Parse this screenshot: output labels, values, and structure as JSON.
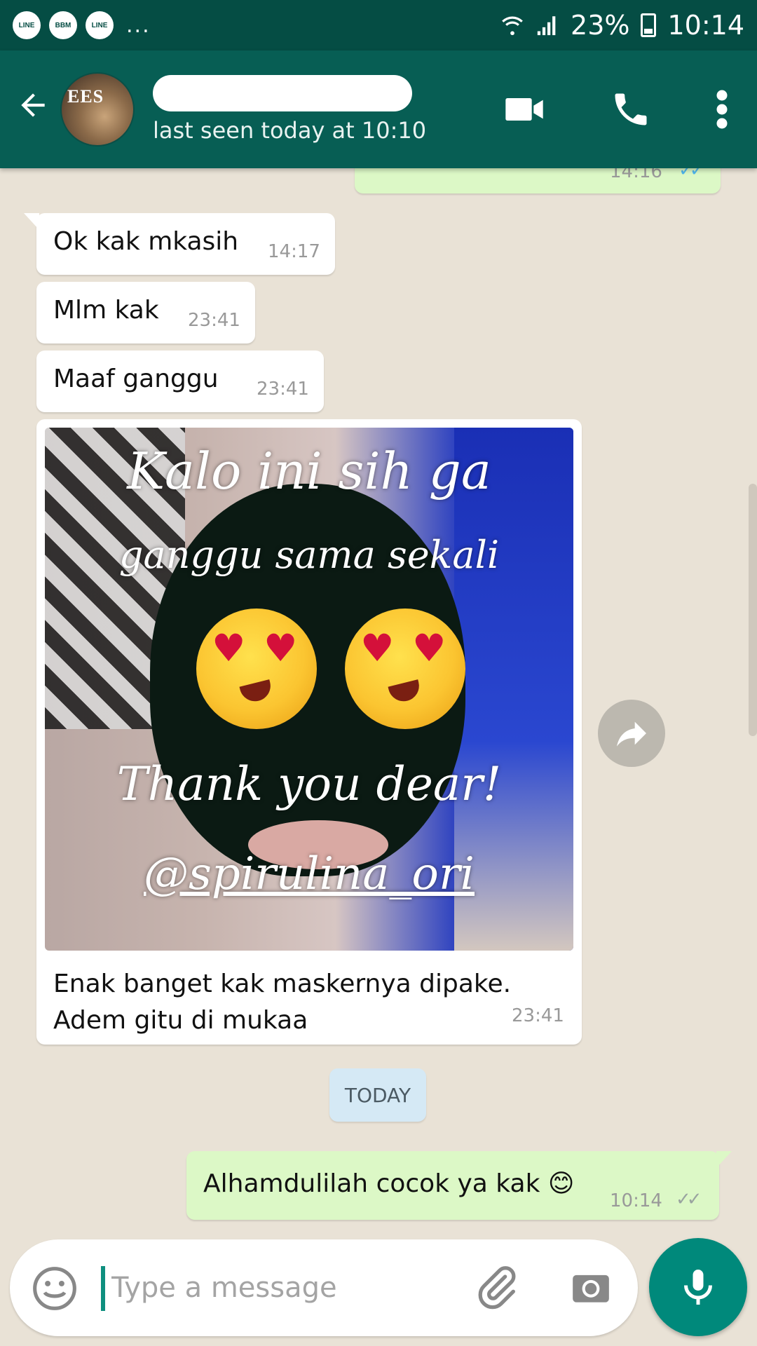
{
  "status_bar": {
    "apps": [
      "LINE",
      "BBM",
      "LINE"
    ],
    "more": "...",
    "battery": "23%",
    "time": "10:14"
  },
  "header": {
    "last_seen": "last seen today at 10:10",
    "avatar_text": "EES"
  },
  "messages": {
    "partial_out_time": "14:16",
    "m1": {
      "text": "Ok kak mkasih",
      "time": "14:17"
    },
    "m2": {
      "text": "Mlm kak",
      "time": "23:41"
    },
    "m3": {
      "text": "Maaf ganggu",
      "time": "23:41"
    },
    "image_msg": {
      "overlay_line1": "Kalo ini sih ga",
      "overlay_line2": "ganggu sama sekali",
      "overlay_line3": "Thank you dear!",
      "overlay_line4": "@spirulina_ori",
      "caption_line1": "Enak banget kak maskernya dipake.",
      "caption_line2": "Adem gitu di mukaa",
      "time": "23:41"
    },
    "date_chip": "TODAY",
    "out1": {
      "text": "Alhamdulilah cocok ya kak 😊",
      "time": "10:14",
      "ticks": "✓✓"
    }
  },
  "composer": {
    "placeholder": "Type a message"
  },
  "colors": {
    "header": "#075e54",
    "status_bar": "#054d44",
    "outgoing": "#dcf8c6",
    "incoming": "#ffffff",
    "fab": "#00897b",
    "chat_bg": "#e9e2d6"
  },
  "icons": [
    "back-arrow-icon",
    "video-call-icon",
    "phone-icon",
    "more-vert-icon",
    "forward-icon",
    "emoji-icon",
    "attach-icon",
    "camera-icon",
    "mic-icon"
  ]
}
